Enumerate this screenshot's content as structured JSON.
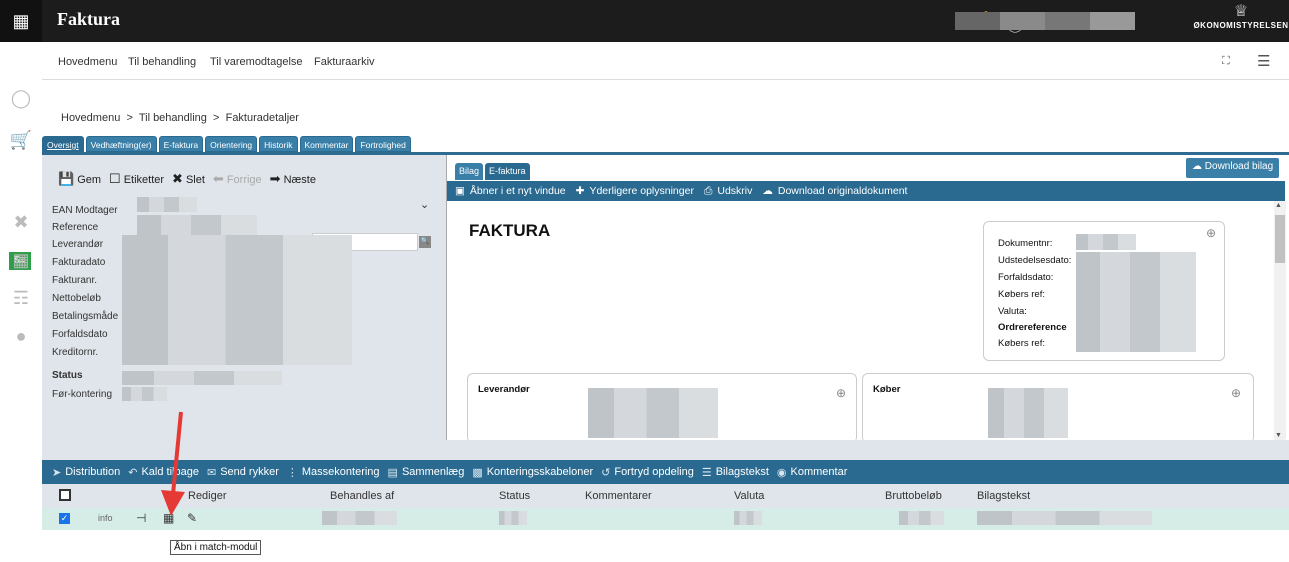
{
  "app": {
    "title": "Faktura",
    "logo_text": "ØKONOMISTYRELSEN"
  },
  "topbar_icons": [
    "bell-icon",
    "help-icon",
    "accessibility-icon",
    "user-icon"
  ],
  "nav": {
    "items": [
      "Hovedmenu",
      "Til behandling",
      "Til varemodtagelse",
      "Fakturaarkiv"
    ]
  },
  "sidebar_active_label": "$≡",
  "breadcrumb": {
    "parts": [
      "Hovedmenu",
      "Til behandling",
      "Fakturadetaljer"
    ],
    "separator": ">"
  },
  "tabs": [
    "Oversigt",
    "Vedhæftning(er)",
    "E-faktura",
    "Orientering",
    "Historik",
    "Kommentar",
    "Fortrolighed"
  ],
  "left_toolbar": {
    "save": "Gem",
    "labels": "Etiketter",
    "delete": "Slet",
    "prev": "Forrige",
    "next": "Næste"
  },
  "fields": [
    "EAN Modtager",
    "Reference",
    "Leverandør",
    "Fakturadato",
    "Fakturanr.",
    "Nettobeløb",
    "Betalingsmåde",
    "Forfaldsdato",
    "Kreditornr."
  ],
  "status_label": "Status",
  "prekontering_label": "Før-kontering",
  "bilag_tabs": [
    "Bilag",
    "E-faktura"
  ],
  "download_bilag": "Download bilag",
  "doc_toolbar": {
    "open_window": "Åbner i et nyt vindue",
    "more_info": "Yderligere oplysninger",
    "print": "Udskriv",
    "download_original": "Download originaldokument"
  },
  "document": {
    "title": "FAKTURA",
    "info_rows": [
      "Dokumentnr:",
      "Udstedelsesdato:",
      "Forfaldsdato:",
      "Købers ref:",
      "Valuta:",
      "Ordrereference",
      "Købers ref:"
    ],
    "supplier_title": "Leverandør",
    "buyer_title": "Køber"
  },
  "actions": {
    "distribution": "Distribution",
    "kald_tilbage": "Kald tilbage",
    "send_rykker": "Send rykker",
    "massekontering": "Massekontering",
    "sammenlaeg": "Sammenlæg",
    "konteringsskabeloner": "Konteringsskabeloner",
    "fortryd_opdeling": "Fortryd opdeling",
    "bilagstekst": "Bilagstekst",
    "kommentar": "Kommentar"
  },
  "table": {
    "headers": {
      "rediger": "Rediger",
      "behandles_af": "Behandles af",
      "status": "Status",
      "kommentarer": "Kommentarer",
      "valuta": "Valuta",
      "bruttobelob": "Bruttobeløb",
      "bilagstekst": "Bilagstekst"
    },
    "row": {
      "info": "info"
    }
  },
  "tooltip": "Åbn i match-modul",
  "colors": {
    "topbar": "#1c1c1c",
    "primary": "#2a6a90",
    "accent_green": "#2e9e4a",
    "arrow": "#e53935"
  }
}
